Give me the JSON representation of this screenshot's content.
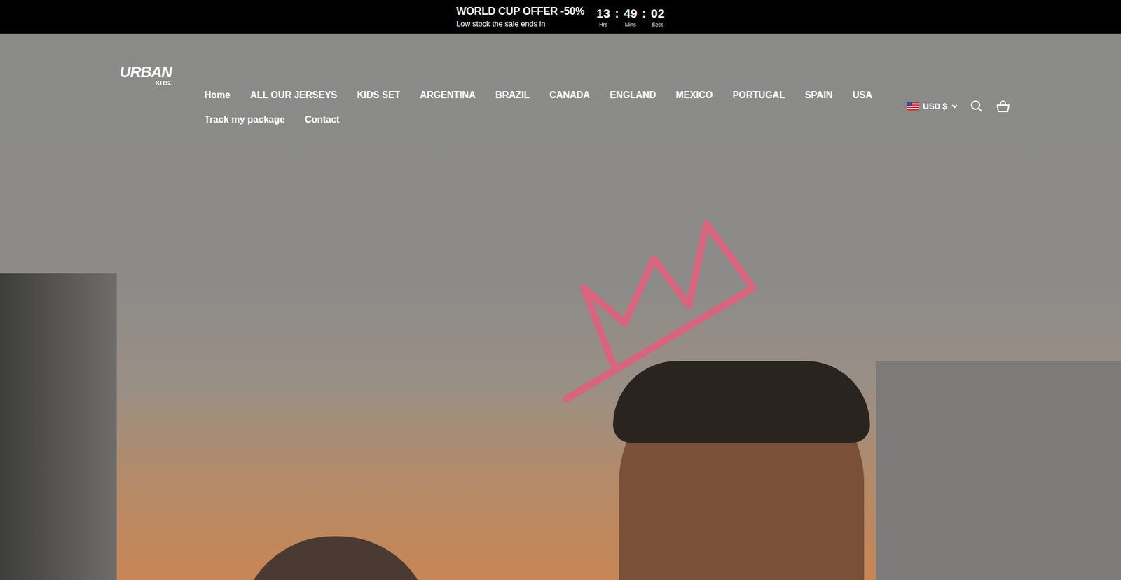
{
  "announcement": {
    "title": "WORLD CUP OFFER -50%",
    "subtitle": "Low stock the sale ends in",
    "separator": ":",
    "timer": [
      {
        "value": "13",
        "unit": "Hrs"
      },
      {
        "value": "49",
        "unit": "Mins"
      },
      {
        "value": "02",
        "unit": "Secs"
      }
    ]
  },
  "logo": {
    "main": "URBAN",
    "sub": "KITS."
  },
  "nav": [
    "Home",
    "ALL OUR JERSEYS",
    "KIDS SET",
    "ARGENTINA",
    "BRAZIL",
    "CANADA",
    "ENGLAND",
    "MEXICO",
    "PORTUGAL",
    "SPAIN",
    "USA",
    "Track my package",
    "Contact"
  ],
  "currency": {
    "label": "USD $"
  }
}
